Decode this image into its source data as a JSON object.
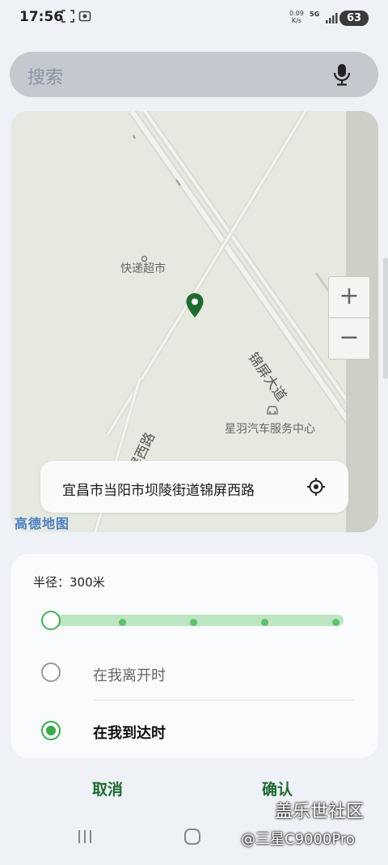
{
  "status_bar": {
    "time": "17:56",
    "net_speed_value": "0.09",
    "net_speed_unit": "K/s",
    "network_type": "5G",
    "battery": "63"
  },
  "search": {
    "placeholder": "搜索"
  },
  "map": {
    "poi_store": "快递超市",
    "poi_service": "星羽汽车服务中心",
    "road_main": "锦屏大道",
    "road_west": "锦屏西路",
    "zoom_in": "+",
    "zoom_out": "−",
    "provider_logo": "高德地图",
    "address": "宜昌市当阳市坝陵街道锦屏西路",
    "pin_color": "#1f6b2f"
  },
  "panel": {
    "radius_label": "半径：300米",
    "slider_steps": 5,
    "slider_value_index": 0,
    "options": [
      {
        "label": "在我离开时",
        "selected": false
      },
      {
        "label": "在我到达时",
        "selected": true
      }
    ]
  },
  "actions": {
    "cancel": "取消",
    "confirm": "确认"
  },
  "watermark": {
    "line1": "盖乐世社区",
    "line2": "@三星C9000Pro"
  },
  "colors": {
    "accent": "#3aaa4c",
    "action_text": "#1f6b2f"
  }
}
